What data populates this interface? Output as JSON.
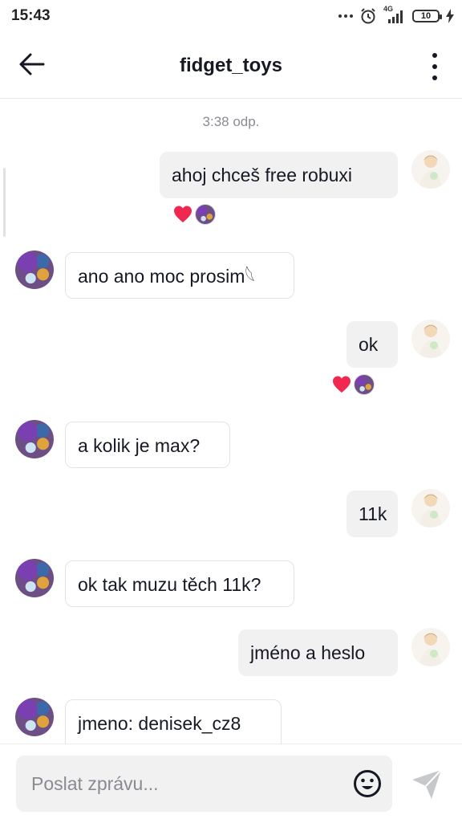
{
  "status_bar": {
    "time": "15:43",
    "network": "4G",
    "battery": "10"
  },
  "header": {
    "title": "fidget_toys"
  },
  "chat": {
    "timestamp": "3:38 odp.",
    "messages": [
      {
        "side": "out",
        "text": "ahoj chceš free robuxi",
        "reactions": [
          "heart"
        ]
      },
      {
        "side": "in",
        "text": "ano ano moc prosim𓆩"
      },
      {
        "side": "out",
        "text": "ok",
        "reactions": [
          "heart"
        ]
      },
      {
        "side": "in",
        "text": "a kolik je max?"
      },
      {
        "side": "out",
        "text": "11k"
      },
      {
        "side": "in",
        "text": "ok tak muzu těch 11k?"
      },
      {
        "side": "out",
        "text": "jméno a heslo"
      },
      {
        "side": "in",
        "text": "jmeno: denisek_cz8"
      }
    ]
  },
  "composer": {
    "placeholder": "Poslat zprávu..."
  },
  "icons": {
    "back": "arrow-left-icon",
    "more": "more-vertical-icon",
    "emoji": "smiley-icon",
    "send": "send-icon",
    "heart_color": "#f02850"
  }
}
